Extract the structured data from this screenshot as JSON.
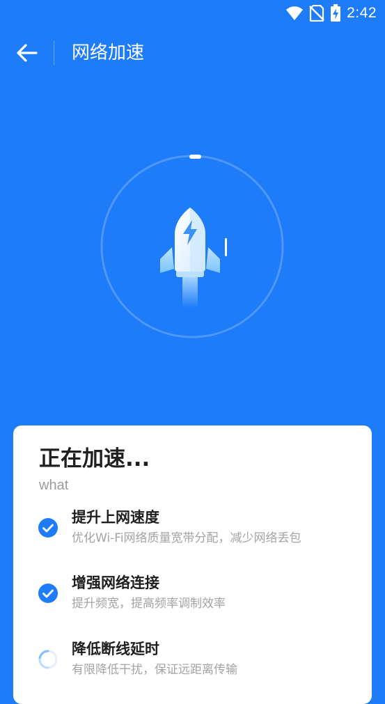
{
  "status_bar": {
    "time": "2:42",
    "icons": [
      "wifi-icon",
      "no-sim-icon",
      "battery-charging-icon"
    ]
  },
  "header": {
    "back_icon": "arrow-left-icon",
    "title": "网络加速"
  },
  "hero": {
    "icon": "rocket-icon",
    "progress": 0.0
  },
  "card": {
    "title": "正在加速...",
    "subtitle": "what",
    "tasks": [
      {
        "title": "提升上网速度",
        "description": "优化Wi-Fi网络质量宽带分配，减少网络丢包",
        "status": "done",
        "icon": "check-circle-icon"
      },
      {
        "title": "增强网络连接",
        "description": "提升频宽，提高频率调制效率",
        "status": "done",
        "icon": "check-circle-icon"
      },
      {
        "title": "降低断线延时",
        "description": "有限降低干扰，保证远距离传输",
        "status": "in-progress",
        "icon": "loading-spinner-icon"
      }
    ]
  },
  "colors": {
    "background": "#1e7cf9",
    "card": "#ffffff",
    "accent": "#1e7cf9",
    "title_text": "#1f1f1f",
    "secondary_text": "#a3a3a3"
  }
}
